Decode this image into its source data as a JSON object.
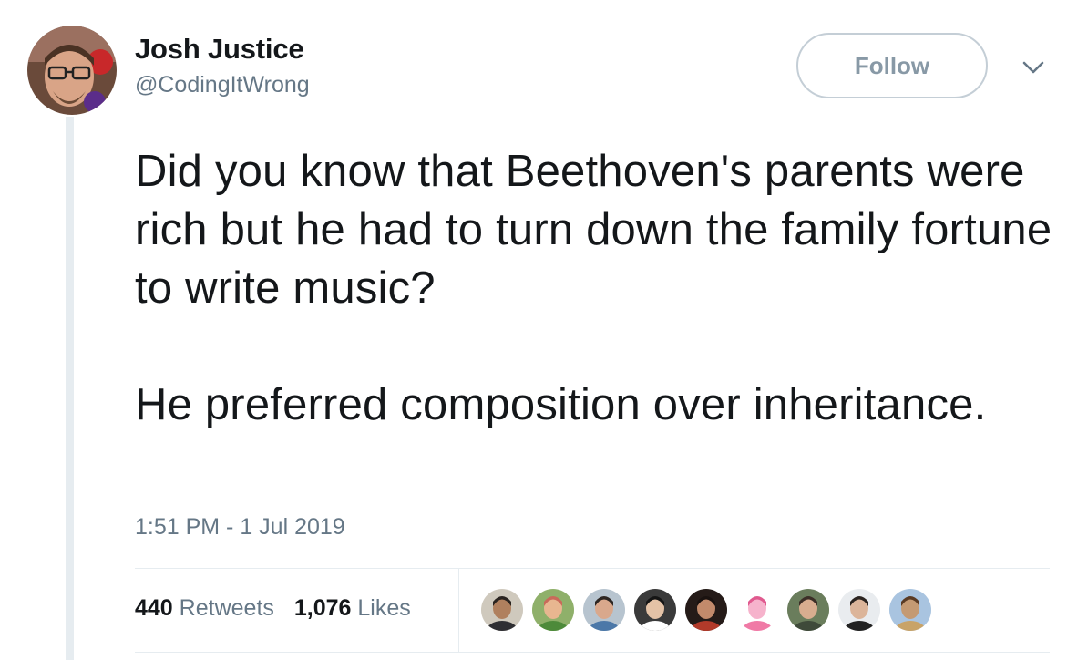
{
  "author": {
    "name": "Josh Justice",
    "handle": "@CodingItWrong"
  },
  "follow_label": "Follow",
  "tweet": {
    "paragraphs": [
      "Did you know that Beethoven's parents were rich but he had to turn down the family fortune to write music?",
      "He preferred composition over inheritance."
    ],
    "timestamp": "1:51 PM - 1 Jul 2019"
  },
  "stats": {
    "retweets_count": "440",
    "retweets_label": "Retweets",
    "likes_count": "1,076",
    "likes_label": "Likes"
  },
  "colors": {
    "text": "#14171a",
    "secondary": "#657786",
    "border": "#e6ecf0",
    "follow_border": "#c4ced6"
  },
  "liker_avatars": [
    {
      "bg": "#cfc9bd",
      "skin": "#b0805e",
      "hair": "#2a2420",
      "shirt": "#2f2f33"
    },
    {
      "bg": "#8fb06a",
      "skin": "#e8b690",
      "hair": "#c96a5a",
      "shirt": "#4d8a3a"
    },
    {
      "bg": "#b7c4cf",
      "skin": "#d9a88c",
      "hair": "#2d2622",
      "shirt": "#4c78a8"
    },
    {
      "bg": "#3a3a3a",
      "skin": "#e4c2a6",
      "hair": "#151515",
      "shirt": "#ffffff"
    },
    {
      "bg": "#251b18",
      "skin": "#c28a6b",
      "hair": "#1a1210",
      "shirt": "#b23a2a"
    },
    {
      "bg": "#ffffff",
      "skin": "#f6b3cc",
      "hair": "#e05a8f",
      "shirt": "#f07aa6"
    },
    {
      "bg": "#6a7d5c",
      "skin": "#d8ad8f",
      "hair": "#3c2f27",
      "shirt": "#3f4a3a"
    },
    {
      "bg": "#e9ecef",
      "skin": "#dcb59a",
      "hair": "#2b2420",
      "shirt": "#222222"
    },
    {
      "bg": "#a9c4e0",
      "skin": "#c49a73",
      "hair": "#5a3b24",
      "shirt": "#c8a368"
    }
  ]
}
